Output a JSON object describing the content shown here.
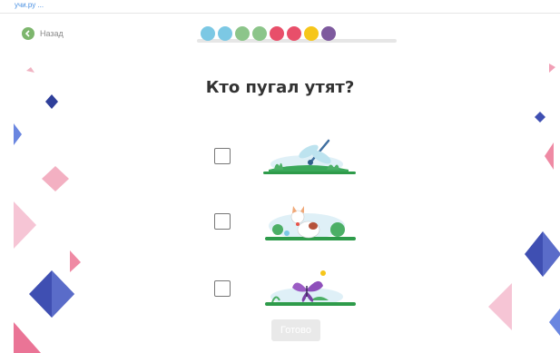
{
  "topbar": {
    "link_text": "учи.ру ..."
  },
  "back": {
    "label": "Назад",
    "icon": "chevron-left-icon"
  },
  "progress": {
    "dot_colors": [
      "#7cc8e4",
      "#7cc8e4",
      "#8cc58a",
      "#8cc58a",
      "#e84f6a",
      "#e84f6a",
      "#f6c61a",
      "#7e5a9e"
    ]
  },
  "question": {
    "title": "Кто пугал утят?"
  },
  "options": [
    {
      "name": "dragonfly",
      "checked": false
    },
    {
      "name": "cat",
      "checked": false
    },
    {
      "name": "butterfly",
      "checked": false
    }
  ],
  "actions": {
    "done_label": "Готово"
  },
  "colors": {
    "accent_green": "#7db66d",
    "deco_pink": "#f19bb0",
    "deco_blue": "#5a6cc9",
    "grass_green": "#2e9b4a"
  }
}
